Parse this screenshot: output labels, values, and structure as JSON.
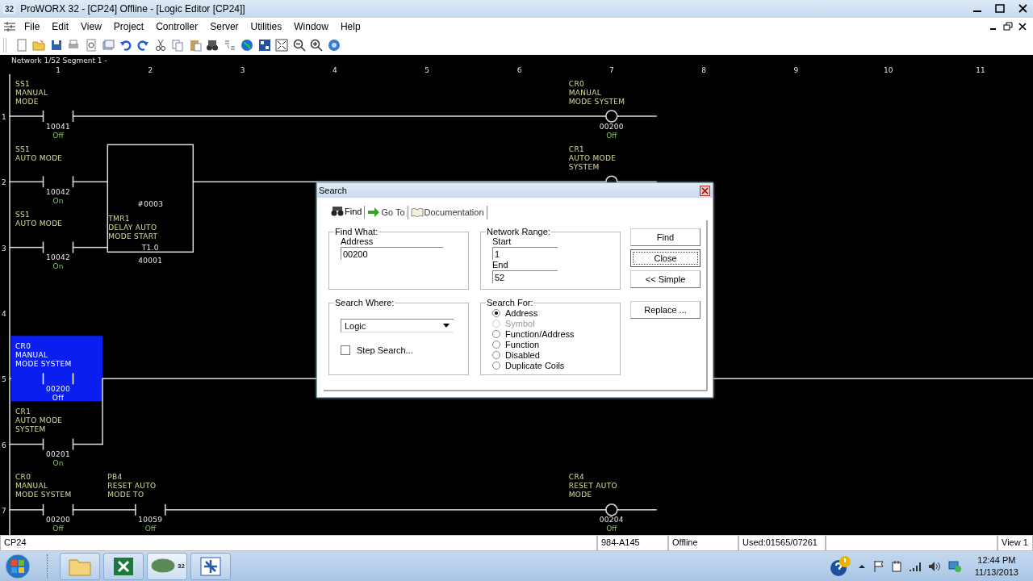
{
  "window": {
    "icon_label": "32",
    "title": "ProWORX 32 - [CP24] Offline - [Logic Editor [CP24]]"
  },
  "menu": [
    "File",
    "Edit",
    "View",
    "Project",
    "Controller",
    "Server",
    "Utilities",
    "Window",
    "Help"
  ],
  "editor": {
    "header": "Network 1/52 Segment 1 -",
    "columns": [
      "1",
      "2",
      "3",
      "4",
      "5",
      "6",
      "7",
      "8",
      "9",
      "10",
      "11"
    ],
    "rungs": [
      {
        "number": "1",
        "contacts": [
          {
            "label": [
              "SS1",
              "MANUAL",
              "MODE"
            ],
            "address": "10041",
            "state": "Off",
            "selected": false
          }
        ],
        "coil": {
          "label": [
            "CR0",
            "MANUAL",
            "MODE SYSTEM"
          ],
          "address": "00200",
          "state": "Off"
        }
      },
      {
        "number": "2",
        "contacts": [
          {
            "label": [
              "SS1",
              "AUTO MODE"
            ],
            "address": "10042",
            "state": "On",
            "selected": false
          }
        ],
        "block": {
          "number": "#0003",
          "label": [
            "TMR1",
            "DELAY AUTO",
            "MODE START"
          ],
          "preset": "T1.0",
          "register": "40001"
        },
        "coil": {
          "label": [
            "CR1",
            "AUTO MODE",
            "SYSTEM"
          ]
        }
      },
      {
        "number": "3",
        "contacts": [
          {
            "label": [
              "SS1",
              "AUTO MODE"
            ],
            "address": "10042",
            "state": "On",
            "selected": false
          }
        ]
      },
      {
        "number": "4"
      },
      {
        "number": "5",
        "continues": true,
        "contacts": [
          {
            "label": [
              "CR0",
              "MANUAL",
              "MODE SYSTEM"
            ],
            "address": "00200",
            "state": "Off",
            "selected": true
          }
        ]
      },
      {
        "number": "6",
        "branch": true,
        "contacts": [
          {
            "label": [
              "CR1",
              "AUTO MODE",
              "SYSTEM"
            ],
            "address": "00201",
            "state": "On",
            "selected": false
          }
        ]
      },
      {
        "number": "7",
        "contacts": [
          {
            "label": [
              "CR0",
              "MANUAL",
              "MODE SYSTEM"
            ],
            "address": "00200",
            "state": "Off",
            "selected": false
          },
          {
            "label": [
              "PB4",
              "RESET AUTO",
              "MODE TO"
            ],
            "address": "10059",
            "state": "Off",
            "selected": false
          }
        ],
        "coil": {
          "label": [
            "CR4",
            "RESET AUTO",
            "MODE"
          ],
          "address": "00204",
          "state": "Off"
        }
      }
    ]
  },
  "dialog": {
    "title": "Search",
    "tabs": [
      {
        "label": "Find",
        "selected": true
      },
      {
        "label": "Go To",
        "selected": false
      },
      {
        "label": "Documentation",
        "selected": false
      }
    ],
    "find_what": {
      "legend": "Find What:",
      "label": "Address",
      "value": "00200"
    },
    "network_range": {
      "legend": "Network Range:",
      "start_label": "Start",
      "start": "1",
      "end_label": "End",
      "end": "52"
    },
    "search_where": {
      "legend": "Search Where:",
      "value": "Logic",
      "step_search": {
        "label": "Step Search...",
        "checked": false
      }
    },
    "search_for": {
      "legend": "Search For:",
      "options": [
        {
          "label": "Address",
          "selected": true,
          "disabled": false
        },
        {
          "label": "Symbol",
          "selected": false,
          "disabled": true
        },
        {
          "label": "Function/Address",
          "selected": false,
          "disabled": false
        },
        {
          "label": "Function",
          "selected": false,
          "disabled": false
        },
        {
          "label": "Disabled",
          "selected": false,
          "disabled": false
        },
        {
          "label": "Duplicate Coils",
          "selected": false,
          "disabled": false
        }
      ]
    },
    "buttons": [
      {
        "label": "Find",
        "focused": false
      },
      {
        "label": "Close",
        "focused": true
      },
      {
        "label": "<< Simple",
        "focused": false
      },
      {
        "label": "Replace ...",
        "focused": false
      }
    ]
  },
  "status_bar": [
    "CP24",
    "984-A145",
    "Offline",
    "Used:01565/07261",
    "View 1"
  ],
  "taskbar": {
    "app_badge": "32",
    "time": "12:44 PM",
    "date": "11/13/2013"
  }
}
